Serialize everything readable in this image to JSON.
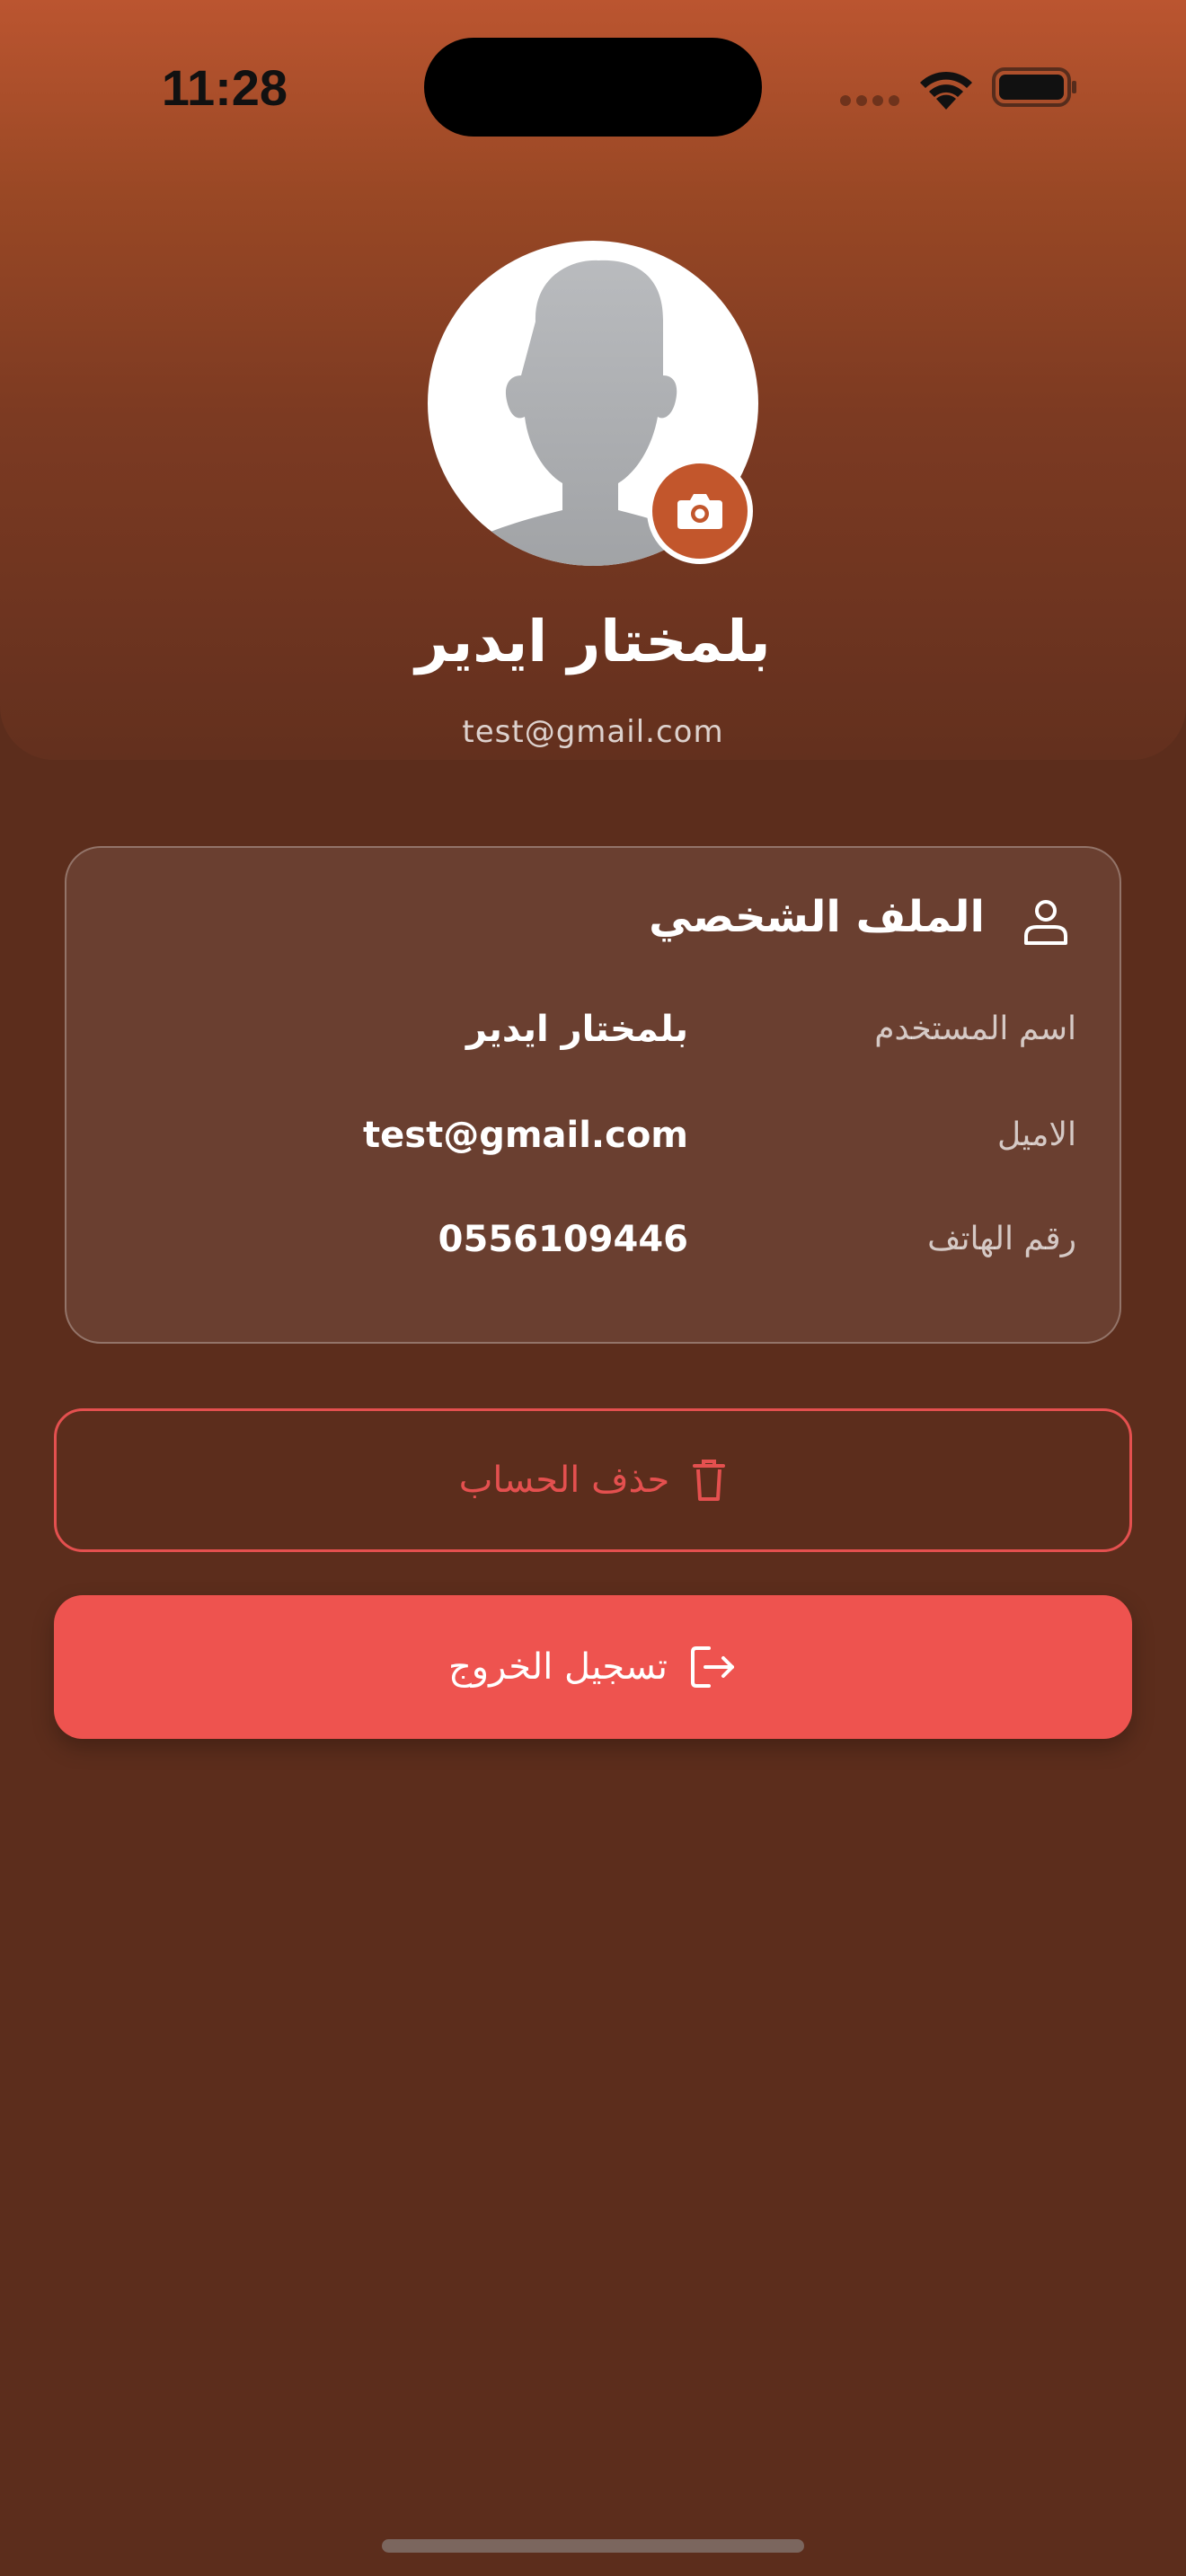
{
  "status_bar": {
    "time": "11:28",
    "icons": [
      "cellular-dots-icon",
      "wifi-icon",
      "battery-icon"
    ]
  },
  "header": {
    "avatar_icon": "default-person-avatar",
    "camera_icon": "camera-icon",
    "name": "بلمختار ايدير",
    "email": "test@gmail.com"
  },
  "profile_card": {
    "title": "الملف الشخصي",
    "title_icon": "person-icon",
    "rows": [
      {
        "label": "اسم المستخدم",
        "value": "بلمختار ايدير"
      },
      {
        "label": "الاميل",
        "value": "test@gmail.com"
      },
      {
        "label": "رقم الهاتف",
        "value": "0556109446"
      }
    ]
  },
  "actions": {
    "delete_label": "حذف الحساب",
    "delete_icon": "trash-icon",
    "logout_label": "تسجيل الخروج",
    "logout_icon": "logout-icon"
  },
  "colors": {
    "accent": "#c2562c",
    "background": "#5c2d1c",
    "danger": "#ee534f"
  }
}
